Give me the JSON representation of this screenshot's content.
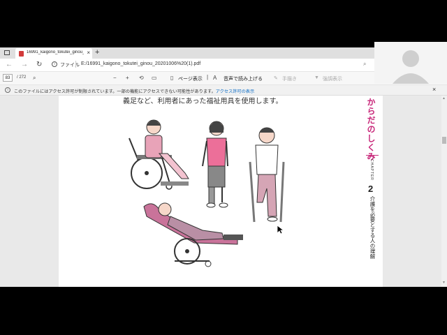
{
  "browser": {
    "tab": {
      "title": "16991_kaigono_tokutei_ginou_2",
      "close": "×"
    },
    "new_tab": "+",
    "back": "←",
    "forward": "→",
    "refresh": "↻",
    "file_label": "ファイル",
    "url": "E:/16991_kaigono_tokutei_ginou_20201006%20(1).pdf",
    "zoom_icon": "search-icon"
  },
  "pdf_toolbar": {
    "current_page": "83",
    "total_pages": "/ 272",
    "page_view": "ページ表示",
    "read_aloud": "音声で読み上げる",
    "handwriting": "手描き",
    "highlight": "強調表示",
    "minus": "−",
    "plus": "+"
  },
  "notice": {
    "text": "このファイルにはアクセス許可が制限されています。一部の機能にアクセスできない可能性があります。",
    "link": "アクセス許可の表示",
    "close": "×"
  },
  "document": {
    "body_text": "義足など、利用者にあった福祉用具を使用します。",
    "sidebar_title": "からだのしくみ",
    "chapter_label": "CHAPTER",
    "chapter_number": "2",
    "chapter_subtitle": "介護を必要とする人の理解"
  },
  "colors": {
    "accent": "#c8287a",
    "link": "#0b6bc4"
  }
}
